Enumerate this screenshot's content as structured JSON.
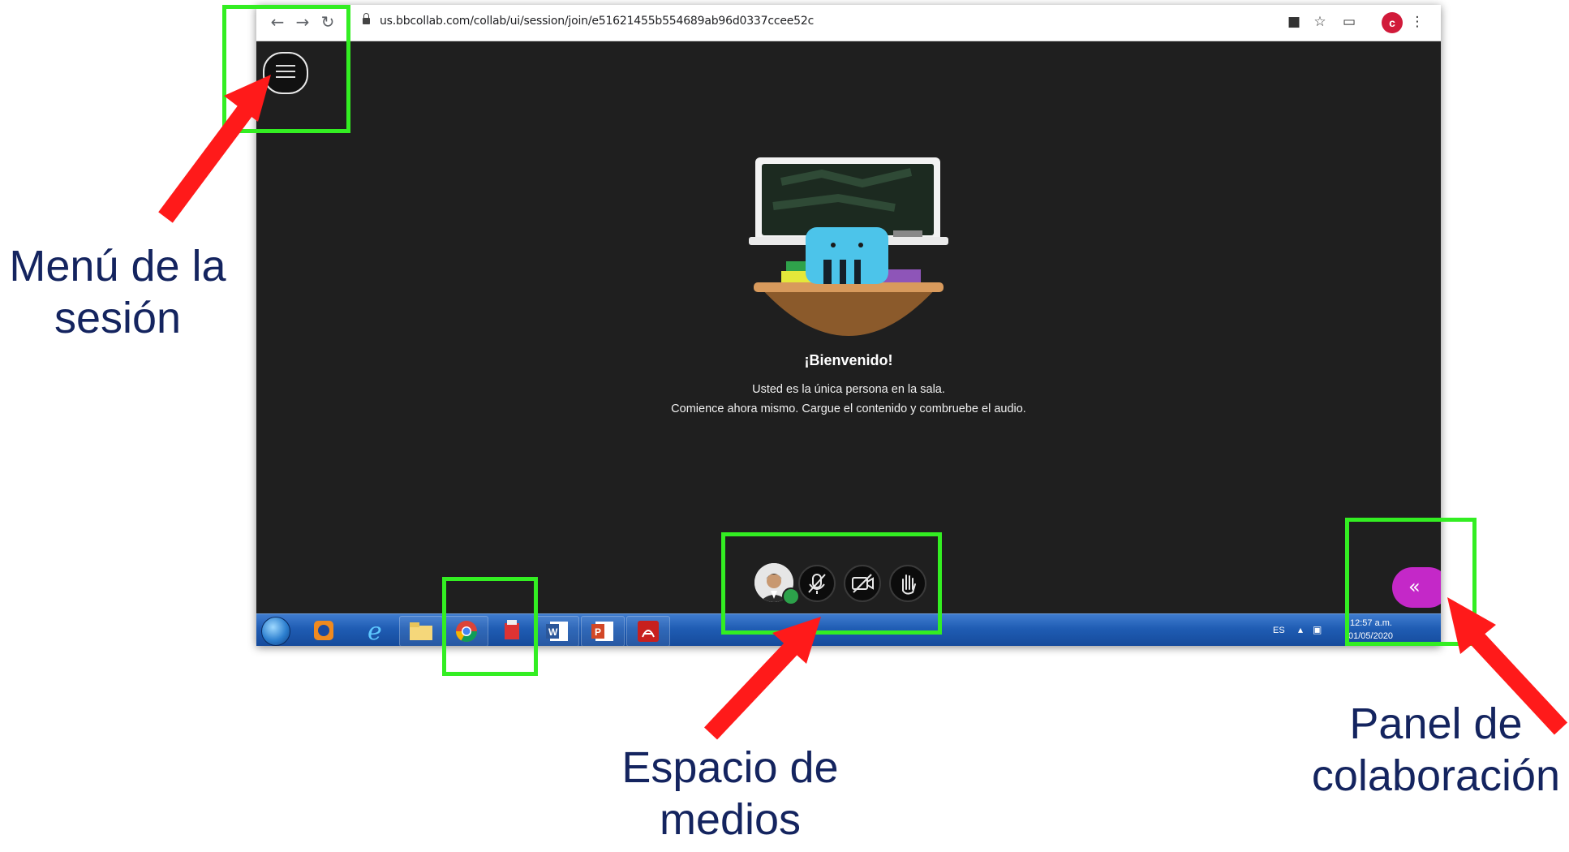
{
  "browser": {
    "url": "us.bbcollab.com/collab/ui/session/join/e51621455b554689ab96d0337ccee52c",
    "profile_initial": "c",
    "icons": [
      "back-arrow-icon",
      "forward-arrow-icon",
      "reload-icon",
      "lock-icon",
      "camera-icon",
      "star-icon",
      "cast-icon",
      "more-vertical-icon"
    ]
  },
  "session": {
    "welcome_title": "¡Bienvenido!",
    "welcome_line1": "Usted es la única persona en la sala.",
    "welcome_line2": "Comience ahora mismo. Cargue el contenido y combruebe el audio.",
    "media_controls": [
      "avatar",
      "microphone-muted-icon",
      "camera-off-icon",
      "raise-hand-icon"
    ],
    "collab_panel_icon": "«"
  },
  "taskbar": {
    "language": "ES",
    "time": "12:57 a.m.",
    "date": "01/05/2020",
    "apps": [
      "windows-start",
      "windows-media-player",
      "internet-explorer",
      "file-explorer",
      "chrome",
      "media-app",
      "word",
      "powerpoint",
      "acrobat"
    ]
  },
  "annotations": {
    "session_menu": [
      "Menú de la",
      "sesión"
    ],
    "media_space": [
      "Espacio de",
      "medios"
    ],
    "collab_panel": [
      "Panel de",
      "colaboración"
    ]
  },
  "colors": {
    "highlight": "#33ee22",
    "arrow": "#ff1a1a",
    "caption": "#14245f",
    "collab_button": "#c428c8"
  }
}
